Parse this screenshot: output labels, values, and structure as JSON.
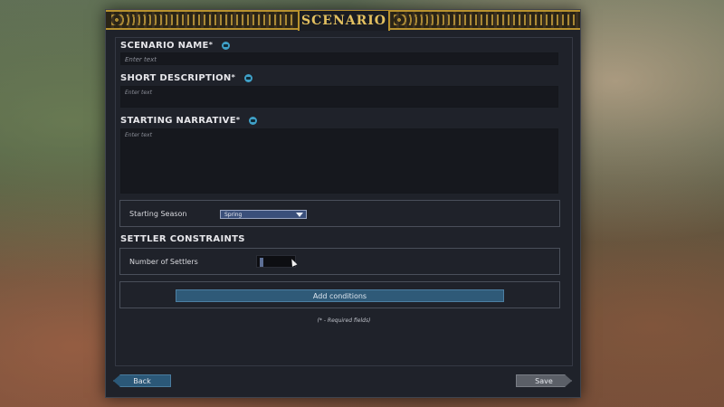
{
  "banner": {
    "title": "SCENARIO"
  },
  "form": {
    "scenario_name": {
      "label": "SCENARIO NAME",
      "required_mark": "*",
      "placeholder": "Enter text"
    },
    "short_description": {
      "label": "SHORT DESCRIPTION",
      "required_mark": "*",
      "placeholder": "Enter text"
    },
    "starting_narrative": {
      "label": "STARTING NARRATIVE",
      "required_mark": "*",
      "placeholder": "Enter text"
    },
    "starting_season": {
      "label": "Starting Season",
      "selected": "Spring"
    },
    "settler_constraints": {
      "heading": "SETTLER CONSTRAINTS",
      "number_of_settlers": {
        "label": "Number of Settlers",
        "value": ""
      }
    },
    "add_conditions_label": "Add conditions",
    "required_note": "(* - Required fields)"
  },
  "footer": {
    "back_label": "Back",
    "save_label": "Save"
  },
  "icons": {
    "info": "info-book-icon",
    "dropdown": "chevron-down-icon"
  },
  "colors": {
    "accent_gold": "#c9a13c",
    "primary_button": "#2f5a78",
    "secondary_button": "#5b5f67"
  }
}
